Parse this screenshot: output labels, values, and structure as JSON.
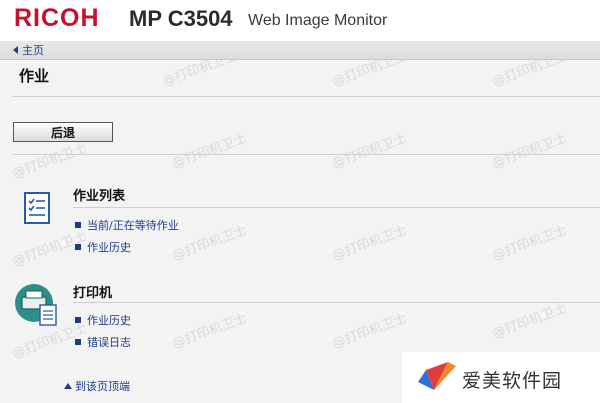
{
  "header": {
    "brand": "RICOH",
    "model": "MP C3504",
    "app_title": "Web Image Monitor",
    "brand_color": "#c8102e"
  },
  "breadcrumb": {
    "home_label": "主页"
  },
  "page": {
    "title": "作业",
    "back_button": "后退"
  },
  "sections": [
    {
      "title": "作业列表",
      "icon": "job-list-icon",
      "links": [
        "当前/正在等待作业",
        "作业历史"
      ]
    },
    {
      "title": "打印机",
      "icon": "printer-icon",
      "links": [
        "作业历史",
        "错误日志"
      ]
    }
  ],
  "footer": {
    "to_top": "到该页顶端"
  },
  "watermark": {
    "brand": "爱美软件园",
    "faint": "@打印机卫士"
  },
  "colors": {
    "link": "#1f3a8a",
    "background": "#f3f3f3"
  }
}
